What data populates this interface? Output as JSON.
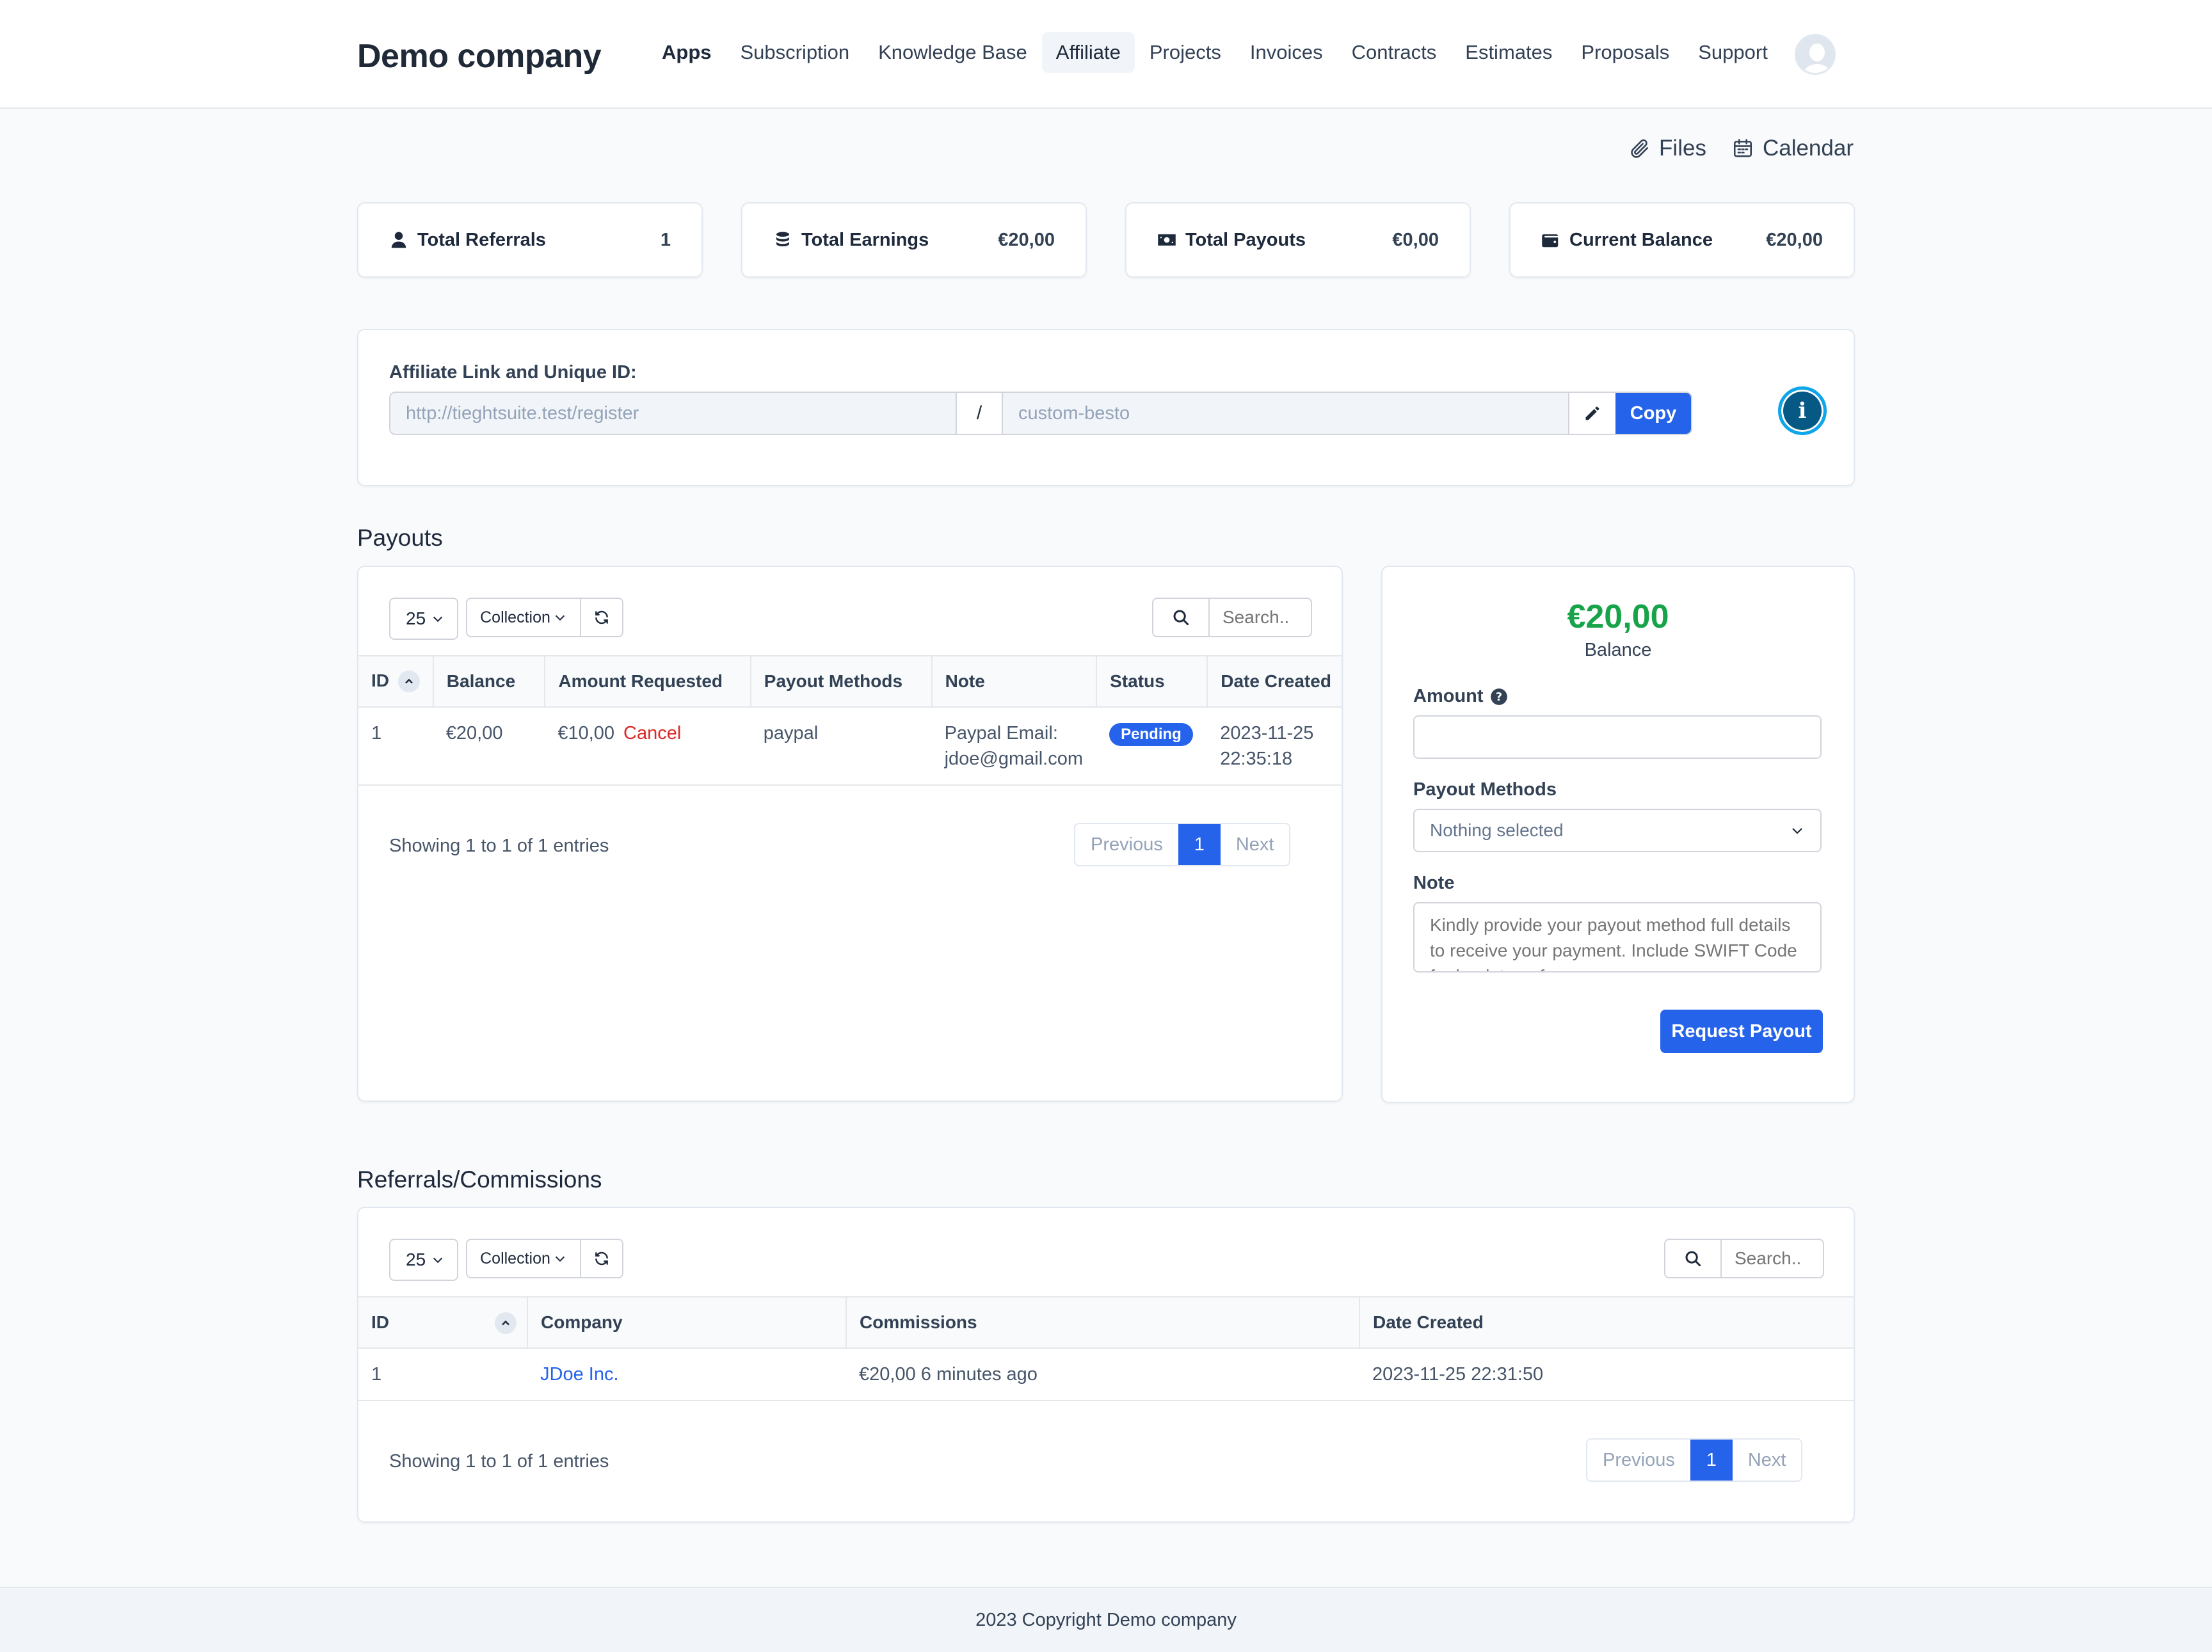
{
  "header": {
    "brand": "Demo company",
    "nav": [
      {
        "label": "Apps"
      },
      {
        "label": "Subscription"
      },
      {
        "label": "Knowledge Base"
      },
      {
        "label": "Affiliate"
      },
      {
        "label": "Projects"
      },
      {
        "label": "Invoices"
      },
      {
        "label": "Contracts"
      },
      {
        "label": "Estimates"
      },
      {
        "label": "Proposals"
      },
      {
        "label": "Support"
      }
    ],
    "active_nav": "Affiliate"
  },
  "actions": {
    "files": "Files",
    "calendar": "Calendar"
  },
  "stats": [
    {
      "label": "Total Referrals",
      "value": "1",
      "icon": "user-icon"
    },
    {
      "label": "Total Earnings",
      "value": "€20,00",
      "icon": "coins-icon"
    },
    {
      "label": "Total Payouts",
      "value": "€0,00",
      "icon": "money-bill-icon"
    },
    {
      "label": "Current Balance",
      "value": "€20,00",
      "icon": "wallet-icon"
    }
  ],
  "affiliate": {
    "label": "Affiliate Link and Unique ID:",
    "base_url": "http://tieghtsuite.test/register",
    "separator": "/",
    "unique_id": "custom-besto",
    "copy_label": "Copy",
    "info_glyph": "i"
  },
  "payouts": {
    "title": "Payouts",
    "page_length": "25",
    "collection_label": "Collection",
    "search_placeholder": "Search..",
    "columns": [
      "ID",
      "Balance",
      "Amount Requested",
      "Payout Methods",
      "Note",
      "Status",
      "Date Created"
    ],
    "rows": [
      {
        "id": "1",
        "balance": "€20,00",
        "amount": "€10,00",
        "cancel": "Cancel",
        "method": "paypal",
        "note_line1": "Paypal Email:",
        "note_line2": "jdoe@gmail.com",
        "status": "Pending",
        "date_line1": "2023-11-25",
        "date_line2": "22:35:18"
      }
    ],
    "showing": "Showing 1 to 1 of 1 entries",
    "pager": {
      "prev": "Previous",
      "current": "1",
      "next": "Next"
    }
  },
  "payout_form": {
    "balance_amount": "€20,00",
    "balance_label": "Balance",
    "amount_label": "Amount",
    "amount_value": "",
    "methods_label": "Payout Methods",
    "methods_selected": "Nothing selected",
    "note_label": "Note",
    "note_placeholder": "Kindly provide your payout method full details to receive your payment. Include SWIFT Code for bank transfer",
    "submit_label": "Request Payout",
    "colors": {
      "balance": "#16a34a",
      "primary": "#2563eb"
    }
  },
  "referrals": {
    "title": "Referrals/Commissions",
    "page_length": "25",
    "collection_label": "Collection",
    "search_placeholder": "Search..",
    "columns": [
      "ID",
      "Company",
      "Commissions",
      "Date Created"
    ],
    "rows": [
      {
        "id": "1",
        "company": "JDoe Inc.",
        "commission": "€20,00 6 minutes ago",
        "date": "2023-11-25 22:31:50"
      }
    ],
    "showing": "Showing 1 to 1 of 1 entries",
    "pager": {
      "prev": "Previous",
      "current": "1",
      "next": "Next"
    }
  },
  "footer": {
    "text": "2023 Copyright Demo company"
  }
}
